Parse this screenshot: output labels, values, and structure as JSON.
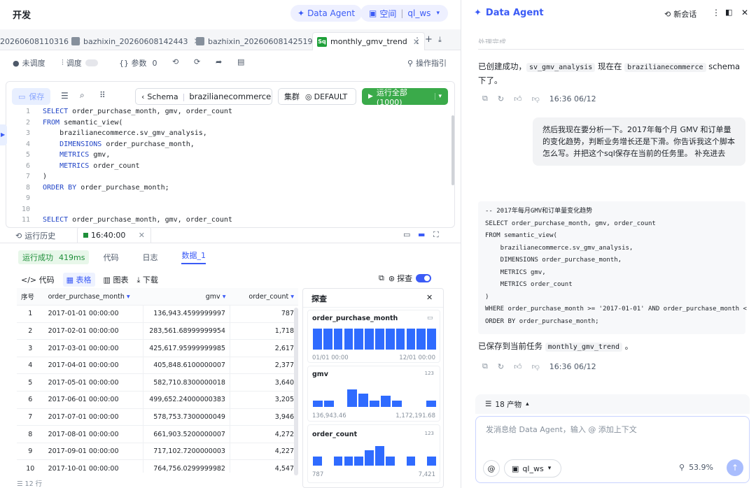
{
  "header": {
    "title": "开发",
    "agent_pill": "Data Agent",
    "space_label": "空间",
    "space_value": "ql_ws"
  },
  "tabs": [
    {
      "label": "20260608110316",
      "active": false
    },
    {
      "label": "bazhixin_20260608142443",
      "active": false
    },
    {
      "label": "bazhixin_20260608142519",
      "active": false
    },
    {
      "label": "monthly_gmv_trend",
      "active": true
    }
  ],
  "toolbar": {
    "unscheduled": "未调度",
    "schedule": "调度",
    "params": "{} 参数",
    "params_count": "0",
    "guide": "操作指引"
  },
  "editor": {
    "save": "保存",
    "schema_label": "Schema",
    "schema_value": "brazilianecommerce",
    "cluster": "集群",
    "cluster_value": "DEFAULT",
    "run_all": "运行全部 (1000)",
    "lines": [
      {
        "n": "1",
        "t": "SELECT order_purchase_month, gmv, order_count"
      },
      {
        "n": "2",
        "t": "FROM semantic_view("
      },
      {
        "n": "3",
        "t": "    brazilianecommerce.sv_gmv_analysis,"
      },
      {
        "n": "4",
        "t": "    DIMENSIONS order_purchase_month,"
      },
      {
        "n": "5",
        "t": "    METRICS gmv,"
      },
      {
        "n": "6",
        "t": "    METRICS order_count"
      },
      {
        "n": "7",
        "t": ")"
      },
      {
        "n": "8",
        "t": "ORDER BY order_purchase_month;"
      },
      {
        "n": "9",
        "t": ""
      },
      {
        "n": "10",
        "t": ""
      },
      {
        "n": "11",
        "t": "SELECT order_purchase_month, gmv, order_count"
      }
    ]
  },
  "results": {
    "history": "运行历史",
    "run_time": "16:40:00",
    "status": "运行成功",
    "duration": "419ms",
    "tab_code": "代码",
    "tab_log": "日志",
    "tab_data": "数据_1",
    "view_code": "代码",
    "view_table": "表格",
    "view_chart": "图表",
    "download": "下载",
    "explore": "探查",
    "columns": [
      "序号",
      "order_purchase_month",
      "gmv",
      "order_count"
    ],
    "rows": [
      [
        "1",
        "2017-01-01 00:00:00",
        "136,943.4599999997",
        "787"
      ],
      [
        "2",
        "2017-02-01 00:00:00",
        "283,561.68999999954",
        "1,718"
      ],
      [
        "3",
        "2017-03-01 00:00:00",
        "425,617.95999999985",
        "2,617"
      ],
      [
        "4",
        "2017-04-01 00:00:00",
        "405,848.6100000007",
        "2,377"
      ],
      [
        "5",
        "2017-05-01 00:00:00",
        "582,710.8300000018",
        "3,640"
      ],
      [
        "6",
        "2017-06-01 00:00:00",
        "499,652.24000000383",
        "3,205"
      ],
      [
        "7",
        "2017-07-01 00:00:00",
        "578,753.7300000049",
        "3,946"
      ],
      [
        "8",
        "2017-08-01 00:00:00",
        "661,903.5200000007",
        "4,272"
      ],
      [
        "9",
        "2017-09-01 00:00:00",
        "717,102.7200000003",
        "4,227"
      ],
      [
        "10",
        "2017-10-01 00:00:00",
        "764,756.0299999982",
        "4,547"
      ]
    ],
    "row_count": "12 行"
  },
  "explore": {
    "title": "探查",
    "card1": {
      "name": "order_purchase_month",
      "min": "01/01 00:00",
      "max": "12/01 00:00",
      "bars": [
        1,
        1,
        1,
        1,
        1,
        1,
        1,
        1,
        1,
        1,
        1,
        1
      ]
    },
    "card2": {
      "name": "gmv",
      "tag": "123",
      "min": "136,943.46",
      "max": "1,172,191.68",
      "bars": [
        0.3,
        0.3,
        0,
        0.85,
        0.65,
        0.3,
        0.55,
        0.3,
        0,
        0,
        0.3
      ]
    },
    "card3": {
      "name": "order_count",
      "tag": "123",
      "min": "787",
      "max": "7,421",
      "bars": [
        0.45,
        0,
        0.45,
        0.45,
        0.45,
        0.8,
        1,
        0.45,
        0,
        0.45,
        0,
        0.45
      ]
    }
  },
  "agent": {
    "title": "Data Agent",
    "new_chat": "新会话",
    "faded": "处理完成",
    "msg1_prefix": "已创建成功，",
    "msg1_chip1": "sv_gmv_analysis",
    "msg1_mid": "现在在",
    "msg1_chip2": "brazilianecommerce",
    "msg1_suffix": "schema 下了。",
    "time1": "16:36 06/12",
    "user_msg": "然后我现在要分析一下。2017年每个月 GMV 和订单量的变化趋势，判断业务增长还是下滑。你告诉我这个脚本怎么写。并把这个sql保存在当前的任务里。 补充进去",
    "code_lines": [
      "-- 2017年每月GMV和订单量变化趋势",
      "SELECT order_purchase_month, gmv, order_count",
      "FROM semantic_view(",
      "    brazilianecommerce.sv_gmv_analysis,",
      "    DIMENSIONS order_purchase_month,",
      "    METRICS gmv,",
      "    METRICS order_count",
      ")",
      "WHERE order_purchase_month >= '2017-01-01' AND order_purchase_month <",
      "ORDER BY order_purchase_month;"
    ],
    "msg2_prefix": "已保存到当前任务",
    "msg2_chip": "monthly_gmv_trend",
    "msg2_suffix": "。",
    "time2": "16:36 06/12",
    "artifacts": "18 产物",
    "input_placeholder": "发消息给 Data Agent，输入 @ 添加上下文",
    "ws": "ql_ws",
    "percent": "53.9%",
    "colors": {
      "accent": "#3b5bf6",
      "run": "#3aaa4a"
    }
  }
}
